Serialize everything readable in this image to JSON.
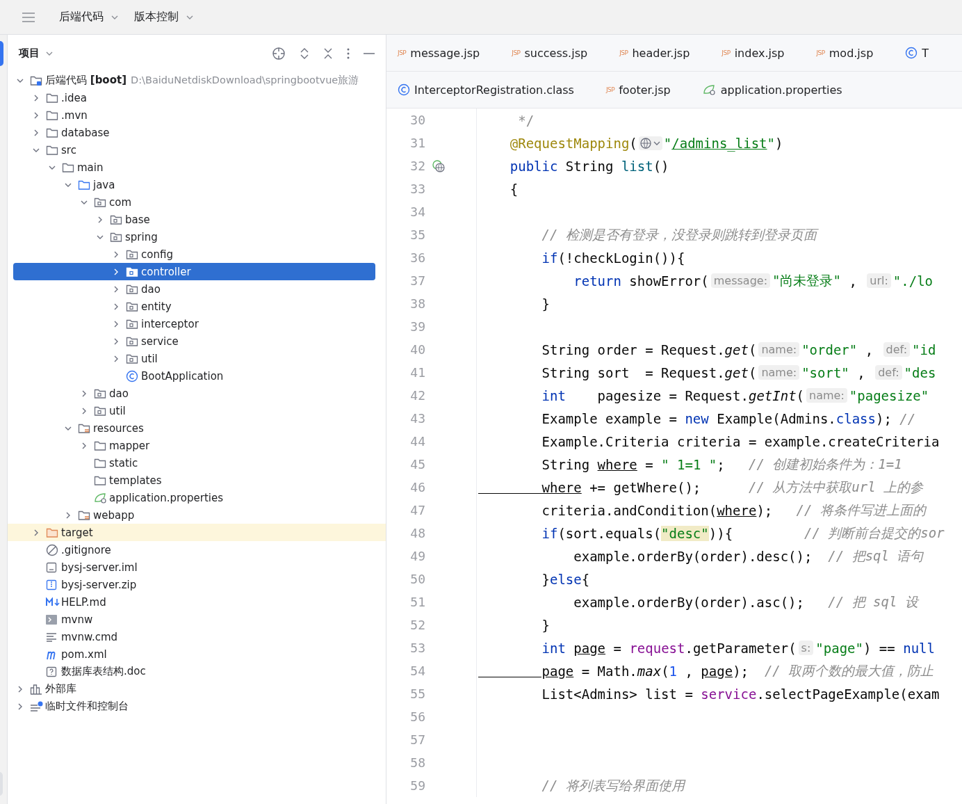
{
  "top_bar": {
    "menus": [
      {
        "label": "后端代码"
      },
      {
        "label": "版本控制"
      }
    ]
  },
  "project_panel": {
    "title": "项目",
    "tree": [
      {
        "label": "后端代码 **[boot]**",
        "path": "D:\\BaiduNetdiskDownload\\springbootvue旅游",
        "kind": "module",
        "expanded": true,
        "selected": false,
        "children": [
          {
            "label": ".idea",
            "kind": "folder",
            "expanded": false,
            "selected": false
          },
          {
            "label": ".mvn",
            "kind": "folder",
            "expanded": false,
            "selected": false
          },
          {
            "label": "database",
            "kind": "folder",
            "expanded": false,
            "selected": false
          },
          {
            "label": "src",
            "kind": "folder",
            "expanded": true,
            "selected": false,
            "children": [
              {
                "label": "main",
                "kind": "folder",
                "expanded": true,
                "selected": false,
                "children": [
                  {
                    "label": "java",
                    "kind": "source-folder",
                    "expanded": true,
                    "selected": false,
                    "children": [
                      {
                        "label": "com",
                        "kind": "package",
                        "expanded": true,
                        "selected": false,
                        "children": [
                          {
                            "label": "base",
                            "kind": "package",
                            "expanded": false,
                            "selected": false
                          },
                          {
                            "label": "spring",
                            "kind": "package",
                            "expanded": true,
                            "selected": false,
                            "children": [
                              {
                                "label": "config",
                                "kind": "package",
                                "expanded": false,
                                "selected": false
                              },
                              {
                                "label": "controller",
                                "kind": "package",
                                "expanded": false,
                                "selected": true
                              },
                              {
                                "label": "dao",
                                "kind": "package",
                                "expanded": false,
                                "selected": false
                              },
                              {
                                "label": "entity",
                                "kind": "package",
                                "expanded": false,
                                "selected": false
                              },
                              {
                                "label": "interceptor",
                                "kind": "package",
                                "expanded": false,
                                "selected": false
                              },
                              {
                                "label": "service",
                                "kind": "package",
                                "expanded": false,
                                "selected": false
                              },
                              {
                                "label": "util",
                                "kind": "package",
                                "expanded": false,
                                "selected": false
                              },
                              {
                                "label": "BootApplication",
                                "kind": "class",
                                "selected": false
                              }
                            ]
                          }
                        ]
                      },
                      {
                        "label": "dao",
                        "kind": "package",
                        "expanded": false,
                        "selected": false
                      },
                      {
                        "label": "util",
                        "kind": "package",
                        "expanded": false,
                        "selected": false
                      }
                    ]
                  },
                  {
                    "label": "resources",
                    "kind": "resource-folder",
                    "expanded": true,
                    "selected": false,
                    "children": [
                      {
                        "label": "mapper",
                        "kind": "folder",
                        "expanded": false,
                        "selected": false
                      },
                      {
                        "label": "static",
                        "kind": "folder",
                        "selected": false
                      },
                      {
                        "label": "templates",
                        "kind": "folder",
                        "selected": false
                      },
                      {
                        "label": "application.properties",
                        "kind": "spring",
                        "selected": false
                      }
                    ]
                  },
                  {
                    "label": "webapp",
                    "kind": "web-folder",
                    "expanded": false,
                    "selected": false
                  }
                ]
              }
            ]
          },
          {
            "label": "target",
            "kind": "excluded-folder",
            "expanded": false,
            "selected": false
          },
          {
            "label": ".gitignore",
            "kind": "ignore",
            "selected": false
          },
          {
            "label": "bysj-server.iml",
            "kind": "iml",
            "selected": false
          },
          {
            "label": "bysj-server.zip",
            "kind": "zip",
            "selected": false
          },
          {
            "label": "HELP.md",
            "kind": "markdown",
            "selected": false
          },
          {
            "label": "mvnw",
            "kind": "shell",
            "selected": false
          },
          {
            "label": "mvnw.cmd",
            "kind": "text",
            "selected": false
          },
          {
            "label": "pom.xml",
            "kind": "maven",
            "selected": false
          },
          {
            "label": "数据库表结构.doc",
            "kind": "unknown",
            "selected": false
          }
        ]
      },
      {
        "label": "外部库",
        "kind": "library",
        "expanded": false,
        "selected": false
      },
      {
        "label": "临时文件和控制台",
        "kind": "scratch",
        "expanded": false,
        "selected": false
      }
    ]
  },
  "editor": {
    "tab_rows": [
      [
        {
          "label": "message.jsp",
          "kind": "jsp",
          "badge": "JSP",
          "selected": false
        },
        {
          "label": "success.jsp",
          "kind": "jsp",
          "badge": "JSP",
          "selected": false
        },
        {
          "label": "header.jsp",
          "kind": "jsp",
          "badge": "JSP",
          "selected": false
        },
        {
          "label": "index.jsp",
          "kind": "jsp",
          "badge": "JSP",
          "selected": false
        },
        {
          "label": "mod.jsp",
          "kind": "jsp",
          "badge": "JSP",
          "selected": false
        },
        {
          "label": "T",
          "kind": "class",
          "selected": false
        }
      ],
      [
        {
          "label": "InterceptorRegistration.class",
          "kind": "class",
          "selected": false
        },
        {
          "label": "footer.jsp",
          "kind": "jsp",
          "badge": "JSP",
          "selected": false
        },
        {
          "label": "application.properties",
          "kind": "spring",
          "selected": false
        }
      ]
    ],
    "lines": [
      {
        "number": "30",
        "endpoint_marker": false,
        "tokens": [
          {
            "kind": "doc",
            "text": "     */"
          }
        ]
      },
      {
        "number": "31",
        "endpoint_marker": false,
        "tokens": [
          {
            "kind": "annotation",
            "text": "    @RequestMapping"
          },
          {
            "kind": "plain",
            "text": "("
          },
          {
            "kind": "endpoint"
          },
          {
            "kind": "string",
            "text": "\""
          },
          {
            "kind": "link",
            "text": "/admins_list"
          },
          {
            "kind": "string",
            "text": "\""
          },
          {
            "kind": "plain",
            "text": ")"
          }
        ]
      },
      {
        "number": "32",
        "endpoint_marker": true,
        "tokens": [
          {
            "kind": "keyword",
            "text": "    public"
          },
          {
            "kind": "plain",
            "text": " String "
          },
          {
            "kind": "declaration",
            "text": "list"
          },
          {
            "kind": "plain",
            "text": "()"
          }
        ]
      },
      {
        "number": "33",
        "endpoint_marker": false,
        "tokens": [
          {
            "kind": "plain",
            "text": "    {"
          }
        ]
      },
      {
        "number": "34",
        "endpoint_marker": false
      },
      {
        "number": "35",
        "endpoint_marker": false,
        "tokens": [
          {
            "kind": "comment",
            "text": "        // 检测是否有登录，没登录则跳转到登录页面"
          }
        ]
      },
      {
        "number": "36",
        "endpoint_marker": false,
        "tokens": [
          {
            "kind": "keyword",
            "text": "        if"
          },
          {
            "kind": "plain",
            "text": "(!checkLogin()){"
          }
        ]
      },
      {
        "number": "37",
        "endpoint_marker": false,
        "tokens": [
          {
            "kind": "keyword",
            "text": "            return"
          },
          {
            "kind": "plain",
            "text": " showError("
          },
          {
            "kind": "hint",
            "text": "message:"
          },
          {
            "kind": "string",
            "text": "\"尚未登录\""
          },
          {
            "kind": "plain",
            "text": " , "
          },
          {
            "kind": "hint",
            "text": "url:"
          },
          {
            "kind": "string",
            "text": "\"./lo"
          }
        ]
      },
      {
        "number": "38",
        "endpoint_marker": false,
        "tokens": [
          {
            "kind": "plain",
            "text": "        }"
          }
        ]
      },
      {
        "number": "39",
        "endpoint_marker": false
      },
      {
        "number": "40",
        "endpoint_marker": false,
        "tokens": [
          {
            "kind": "plain",
            "text": "        String order = Request."
          },
          {
            "kind": "static",
            "text": "get"
          },
          {
            "kind": "plain",
            "text": "("
          },
          {
            "kind": "hint",
            "text": "name:"
          },
          {
            "kind": "string",
            "text": "\"order\""
          },
          {
            "kind": "plain",
            "text": " , "
          },
          {
            "kind": "hint",
            "text": "def:"
          },
          {
            "kind": "string",
            "text": "\"id"
          }
        ]
      },
      {
        "number": "41",
        "endpoint_marker": false,
        "tokens": [
          {
            "kind": "plain",
            "text": "        String sort  = Request."
          },
          {
            "kind": "static",
            "text": "get"
          },
          {
            "kind": "plain",
            "text": "("
          },
          {
            "kind": "hint",
            "text": "name:"
          },
          {
            "kind": "string",
            "text": "\"sort\""
          },
          {
            "kind": "plain",
            "text": " , "
          },
          {
            "kind": "hint",
            "text": "def:"
          },
          {
            "kind": "string",
            "text": "\"des"
          }
        ]
      },
      {
        "number": "42",
        "endpoint_marker": false,
        "tokens": [
          {
            "kind": "keyword",
            "text": "        int"
          },
          {
            "kind": "plain",
            "text": "    pagesize = Request."
          },
          {
            "kind": "static",
            "text": "getInt"
          },
          {
            "kind": "plain",
            "text": "("
          },
          {
            "kind": "hint",
            "text": "name:"
          },
          {
            "kind": "string",
            "text": "\"pagesize\""
          }
        ]
      },
      {
        "number": "43",
        "endpoint_marker": false,
        "tokens": [
          {
            "kind": "plain",
            "text": "        Example example = "
          },
          {
            "kind": "keyword",
            "text": "new"
          },
          {
            "kind": "plain",
            "text": " Example(Admins."
          },
          {
            "kind": "keyword",
            "text": "class"
          },
          {
            "kind": "plain",
            "text": "); "
          },
          {
            "kind": "comment",
            "text": "//"
          }
        ]
      },
      {
        "number": "44",
        "endpoint_marker": false,
        "tokens": [
          {
            "kind": "plain",
            "text": "        Example.Criteria criteria = example.createCriteria"
          }
        ]
      },
      {
        "number": "45",
        "endpoint_marker": false,
        "tokens": [
          {
            "kind": "plain",
            "text": "        String "
          },
          {
            "kind": "reassigned",
            "text": "where"
          },
          {
            "kind": "plain",
            "text": " = "
          },
          {
            "kind": "string",
            "text": "\" 1=1 \""
          },
          {
            "kind": "plain",
            "text": ";   "
          },
          {
            "kind": "comment",
            "text": "// 创建初始条件为：1=1"
          }
        ]
      },
      {
        "number": "46",
        "endpoint_marker": false,
        "tokens": [
          {
            "kind": "reassigned",
            "text": "        where"
          },
          {
            "kind": "plain",
            "text": " += getWhere();      "
          },
          {
            "kind": "comment",
            "text": "// 从方法中获取url 上的参"
          }
        ]
      },
      {
        "number": "47",
        "endpoint_marker": false,
        "tokens": [
          {
            "kind": "plain",
            "text": "        criteria.andCondition("
          },
          {
            "kind": "reassigned",
            "text": "where"
          },
          {
            "kind": "plain",
            "text": ");   "
          },
          {
            "kind": "comment",
            "text": "// 将条件写进上面的"
          }
        ]
      },
      {
        "number": "48",
        "endpoint_marker": false,
        "tokens": [
          {
            "kind": "keyword",
            "text": "        if"
          },
          {
            "kind": "plain",
            "text": "(sort.equals("
          },
          {
            "kind": "string-match",
            "text": "\"desc\""
          },
          {
            "kind": "plain",
            "text": ")){         "
          },
          {
            "kind": "comment",
            "text": "// 判断前台提交的sor"
          }
        ]
      },
      {
        "number": "49",
        "endpoint_marker": false,
        "tokens": [
          {
            "kind": "plain",
            "text": "            example.orderBy(order).desc();  "
          },
          {
            "kind": "comment",
            "text": "// 把sql 语句"
          }
        ]
      },
      {
        "number": "50",
        "endpoint_marker": false,
        "tokens": [
          {
            "kind": "plain",
            "text": "        }"
          },
          {
            "kind": "keyword",
            "text": "else"
          },
          {
            "kind": "plain",
            "text": "{"
          }
        ]
      },
      {
        "number": "51",
        "endpoint_marker": false,
        "tokens": [
          {
            "kind": "plain",
            "text": "            example.orderBy(order).asc();   "
          },
          {
            "kind": "comment",
            "text": "// 把 sql 设"
          }
        ]
      },
      {
        "number": "52",
        "endpoint_marker": false,
        "tokens": [
          {
            "kind": "plain",
            "text": "        }"
          }
        ]
      },
      {
        "number": "53",
        "endpoint_marker": false,
        "tokens": [
          {
            "kind": "keyword",
            "text": "        int "
          },
          {
            "kind": "reassigned",
            "text": "page"
          },
          {
            "kind": "plain",
            "text": " = "
          },
          {
            "kind": "field",
            "text": "request"
          },
          {
            "kind": "plain",
            "text": ".getParameter("
          },
          {
            "kind": "hint",
            "text": "s:"
          },
          {
            "kind": "string",
            "text": "\"page\""
          },
          {
            "kind": "plain",
            "text": ") == "
          },
          {
            "kind": "keyword",
            "text": "null"
          }
        ]
      },
      {
        "number": "54",
        "endpoint_marker": false,
        "tokens": [
          {
            "kind": "reassigned",
            "text": "        page"
          },
          {
            "kind": "plain",
            "text": " = Math."
          },
          {
            "kind": "static",
            "text": "max"
          },
          {
            "kind": "plain",
            "text": "("
          },
          {
            "kind": "number",
            "text": "1"
          },
          {
            "kind": "plain",
            "text": " , "
          },
          {
            "kind": "reassigned",
            "text": "page"
          },
          {
            "kind": "plain",
            "text": ");  "
          },
          {
            "kind": "comment",
            "text": "// 取两个数的最大值，防止"
          }
        ]
      },
      {
        "number": "55",
        "endpoint_marker": false,
        "tokens": [
          {
            "kind": "plain",
            "text": "        List<Admins> list = "
          },
          {
            "kind": "field",
            "text": "service"
          },
          {
            "kind": "plain",
            "text": ".selectPageExample(exam"
          }
        ]
      },
      {
        "number": "56",
        "endpoint_marker": false
      },
      {
        "number": "57",
        "endpoint_marker": false
      },
      {
        "number": "58",
        "endpoint_marker": false
      },
      {
        "number": "59",
        "endpoint_marker": false,
        "tokens": [
          {
            "kind": "comment",
            "text": "        // 将列表写给界面使用"
          }
        ]
      }
    ]
  }
}
